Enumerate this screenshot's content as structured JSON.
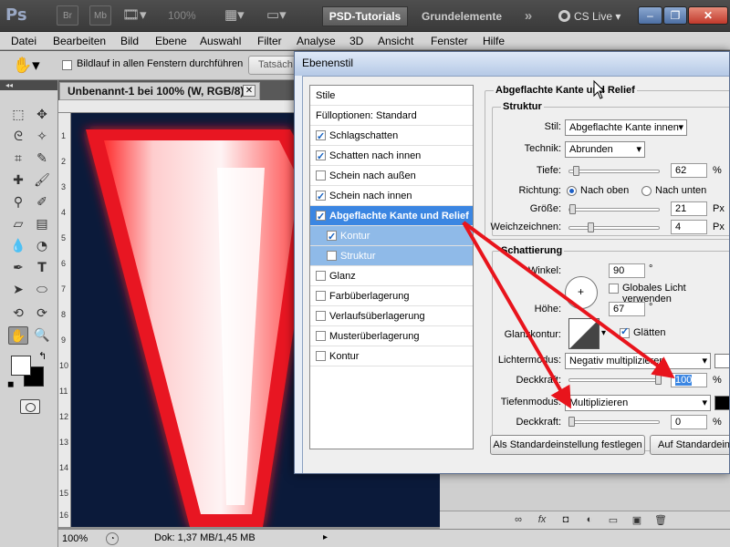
{
  "titlebar": {
    "logo": "Ps",
    "bridge_label": "Br",
    "minibridge_label": "Mb",
    "zoom": "100%",
    "workspace_active": "PSD-Tutorials",
    "workspace_other": "Grundelemente",
    "more": "»",
    "cs_live": "CS Live",
    "window_min": "–",
    "window_restore": "❐",
    "window_close": "✕"
  },
  "menu": [
    "Datei",
    "Bearbeiten",
    "Bild",
    "Ebene",
    "Auswahl",
    "Filter",
    "Analyse",
    "3D",
    "Ansicht",
    "Fenster",
    "Hilfe"
  ],
  "options": {
    "scroll_all_label": "Bildlauf in allen Fenstern durchführen",
    "scroll_all_checked": false,
    "button_label": "Tatsäch"
  },
  "document": {
    "tab_title": "Unbenannt-1 bei 100% (W, RGB/8) *",
    "close": "✕",
    "ruler_left": [
      "1",
      "2",
      "3",
      "4",
      "5",
      "6",
      "7",
      "8",
      "9",
      "10",
      "11",
      "12",
      "13",
      "14",
      "15",
      "16",
      "17",
      "18",
      "19",
      "20"
    ],
    "zoom": "100%",
    "doc_info": "Dok: 1,37 MB/1,45 MB",
    "canvas_letter": "V"
  },
  "tools": {
    "header": "◂◂"
  },
  "dialog": {
    "title": "Ebenenstil",
    "styles_header": "Stile",
    "fill_options": "Fülloptionen: Standard",
    "styles": [
      {
        "label": "Schlagschatten",
        "checked": true
      },
      {
        "label": "Schatten nach innen",
        "checked": true
      },
      {
        "label": "Schein nach außen",
        "checked": false
      },
      {
        "label": "Schein nach innen",
        "checked": true
      },
      {
        "label": "Abgeflachte Kante und Relief",
        "checked": true
      },
      {
        "label": "Kontur",
        "checked": true
      },
      {
        "label": "Struktur",
        "checked": false
      },
      {
        "label": "Glanz",
        "checked": false
      },
      {
        "label": "Farbüberlagerung",
        "checked": false
      },
      {
        "label": "Verlaufsüberlagerung",
        "checked": false
      },
      {
        "label": "Musterüberlagerung",
        "checked": false
      },
      {
        "label": "Kontur",
        "checked": false
      }
    ],
    "section_title": "Abgeflachte Kante und Relief",
    "struktur": {
      "title": "Struktur",
      "stil_label": "Stil:",
      "stil_value": "Abgeflachte Kante innen",
      "technik_label": "Technik:",
      "technik_value": "Abrunden",
      "tiefe_label": "Tiefe:",
      "tiefe_value": "62",
      "tiefe_unit": "%",
      "richtung_label": "Richtung:",
      "nach_oben": "Nach oben",
      "nach_unten": "Nach unten",
      "groesse_label": "Größe:",
      "groesse_value": "21",
      "groesse_unit": "Px",
      "weich_label": "Weichzeichnen:",
      "weich_value": "4",
      "weich_unit": "Px"
    },
    "schattierung": {
      "title": "Schattierung",
      "winkel_label": "Winkel:",
      "winkel_value": "90",
      "winkel_unit": "°",
      "global_light_label": "Globales Licht verwenden",
      "hoehe_label": "Höhe:",
      "hoehe_value": "67",
      "hoehe_unit": "°",
      "glanz_label": "Glanzkontur:",
      "glaetten_label": "Glätten",
      "lichter_label": "Lichtermodus:",
      "lichter_value": "Negativ multiplizieren",
      "deckkraft1_label": "Deckkraft:",
      "deckkraft1_value": "100",
      "deckkraft1_unit": "%",
      "tiefen_label": "Tiefenmodus:",
      "tiefen_value": "Multiplizieren",
      "deckkraft2_label": "Deckkraft:",
      "deckkraft2_value": "0",
      "deckkraft2_unit": "%"
    },
    "btn_set_default": "Als Standardeinstellung festlegen",
    "btn_reset_default": "Auf Standardeinst"
  },
  "layers_footer": [
    "∞",
    "fx",
    "◘",
    "◐",
    "▭",
    "▣",
    "🗑"
  ],
  "colors": {
    "accent_blue": "#3b86e2",
    "canvas_bg": "#0b1a3a",
    "arrow_red": "#e8141c",
    "letter_glow": "#ff4040"
  }
}
